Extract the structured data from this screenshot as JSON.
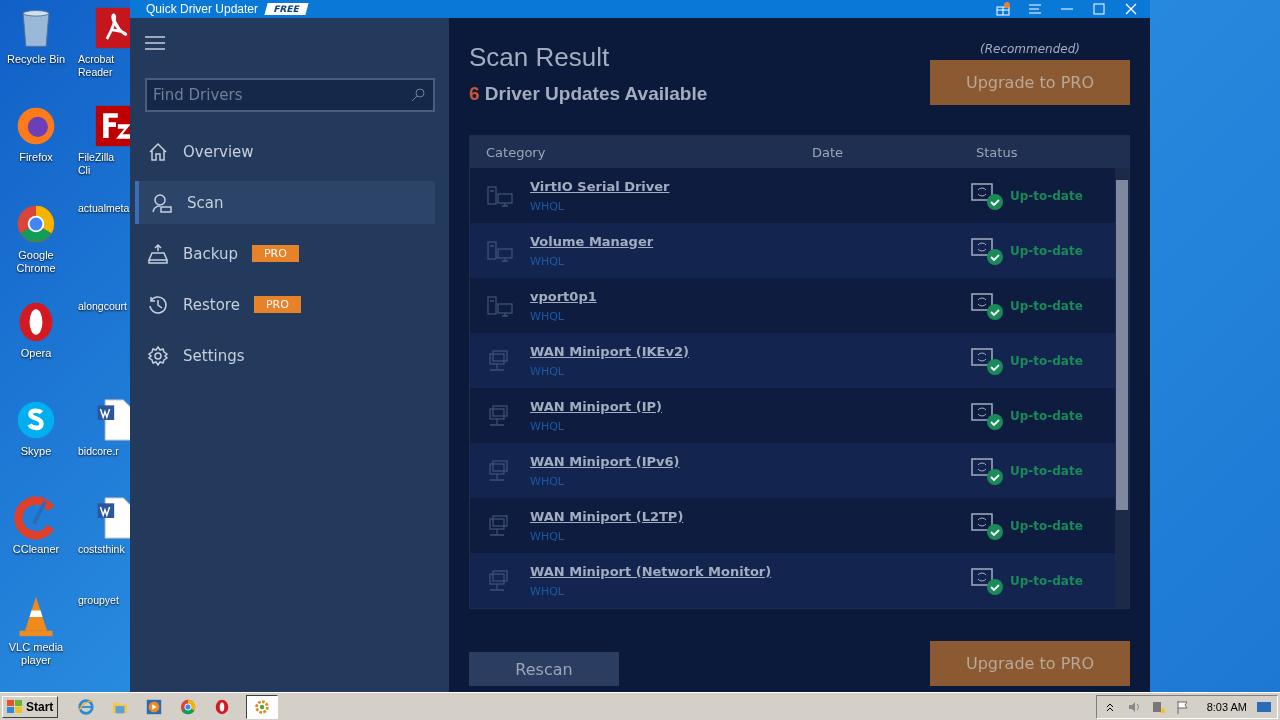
{
  "desktop": {
    "columns": [
      [
        {
          "label": "Recycle Bin",
          "kind": "bin"
        },
        {
          "label": "Firefox",
          "kind": "firefox"
        },
        {
          "label": "Google Chrome",
          "kind": "chrome"
        },
        {
          "label": "Opera",
          "kind": "opera"
        },
        {
          "label": "Skype",
          "kind": "skype"
        },
        {
          "label": "CCleaner",
          "kind": "ccleaner"
        },
        {
          "label": "VLC media player",
          "kind": "vlc"
        }
      ],
      [
        {
          "label": "Acrobat Reader",
          "kind": "acrobat"
        },
        {
          "label": "FileZilla Cli",
          "kind": "filezilla"
        },
        {
          "label": "actualmeta",
          "kind": "blank"
        },
        {
          "label": "alongcourt",
          "kind": "blank"
        },
        {
          "label": "bidcore.r",
          "kind": "word"
        },
        {
          "label": "coststhink",
          "kind": "word"
        },
        {
          "label": "groupyet",
          "kind": "blank"
        }
      ]
    ]
  },
  "window": {
    "title": "Quick Driver Updater",
    "badge": "FREE"
  },
  "sidebar": {
    "search": {
      "placeholder": "Find Drivers"
    },
    "items": [
      {
        "label": "Overview",
        "kind": "home",
        "selected": false
      },
      {
        "label": "Scan",
        "kind": "scan",
        "selected": true
      },
      {
        "label": "Backup",
        "kind": "backup",
        "selected": false,
        "badge": "PRO"
      },
      {
        "label": "Restore",
        "kind": "restore",
        "selected": false,
        "badge": "PRO"
      },
      {
        "label": "Settings",
        "kind": "settings",
        "selected": false
      }
    ]
  },
  "main": {
    "title": "Scan Result",
    "count": "6",
    "subtitle": "Driver Updates Available",
    "recommended": "(Recommended)",
    "upgrade": "Upgrade to PRO",
    "table": {
      "columns": [
        "Category",
        "Date",
        "Status"
      ],
      "rows": [
        {
          "name": "VirtIO Serial Driver",
          "cert": "WHQL",
          "status": "Up-to-date",
          "kind": "device"
        },
        {
          "name": "Volume Manager",
          "cert": "WHQL",
          "status": "Up-to-date",
          "kind": "device"
        },
        {
          "name": "vport0p1",
          "cert": "WHQL",
          "status": "Up-to-date",
          "kind": "device"
        },
        {
          "name": "WAN Miniport (IKEv2)",
          "cert": "WHQL",
          "status": "Up-to-date",
          "kind": "network"
        },
        {
          "name": "WAN Miniport (IP)",
          "cert": "WHQL",
          "status": "Up-to-date",
          "kind": "network"
        },
        {
          "name": "WAN Miniport (IPv6)",
          "cert": "WHQL",
          "status": "Up-to-date",
          "kind": "network"
        },
        {
          "name": "WAN Miniport (L2TP)",
          "cert": "WHQL",
          "status": "Up-to-date",
          "kind": "network"
        },
        {
          "name": "WAN Miniport (Network Monitor)",
          "cert": "WHQL",
          "status": "Up-to-date",
          "kind": "network"
        }
      ]
    },
    "rescan": "Rescan",
    "upgrade_bottom": "Upgrade to PRO"
  },
  "taskbar": {
    "start": "Start",
    "apps": [
      {
        "kind": "ie",
        "selected": false
      },
      {
        "kind": "folder",
        "selected": false
      },
      {
        "kind": "media",
        "selected": false
      },
      {
        "kind": "chrome",
        "selected": false
      },
      {
        "kind": "opera",
        "selected": false
      },
      {
        "kind": "gear",
        "selected": true
      }
    ],
    "time": "8:03 AM"
  }
}
